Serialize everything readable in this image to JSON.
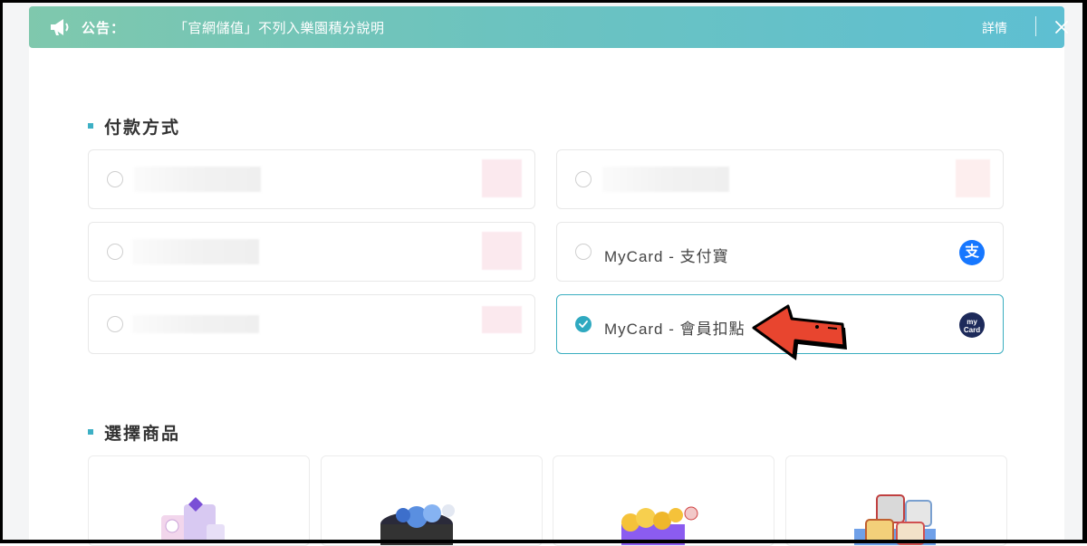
{
  "notice": {
    "label": "公告：",
    "message": "「官網儲值」不列入樂園積分說明",
    "details_label": "詳情"
  },
  "sections": {
    "payment_title": "付款方式",
    "product_title": "選擇商品"
  },
  "payment_options": [
    {
      "label": "",
      "selected": false
    },
    {
      "label": "",
      "selected": false
    },
    {
      "label": "",
      "selected": false
    },
    {
      "label": "MyCard - 支付寶",
      "selected": false,
      "icon": "alipay-icon"
    },
    {
      "label": "",
      "selected": false
    },
    {
      "label": "MyCard - 會員扣點",
      "selected": true,
      "icon": "mycard-icon"
    }
  ],
  "mycard_logo_text": "Card",
  "alipay_glyph": "支",
  "colors": {
    "accent": "#3aaec0",
    "notice_start": "#7fc8ad",
    "notice_end": "#5ebfd2",
    "arrow": "#e8452f"
  }
}
